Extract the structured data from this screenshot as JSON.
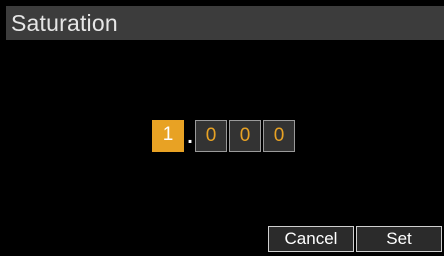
{
  "dialog": {
    "title": "Saturation"
  },
  "value_editor": {
    "digits": [
      "1",
      "0",
      "0",
      "0"
    ],
    "decimal_separator": ".",
    "selected_index": 0
  },
  "buttons": {
    "cancel_label": "Cancel",
    "set_label": "Set"
  },
  "colors": {
    "background": "#000000",
    "title_bar": "#3c3c3c",
    "accent": "#e8a224",
    "digit_box": "#333333",
    "button_border": "#d0d0d0"
  }
}
